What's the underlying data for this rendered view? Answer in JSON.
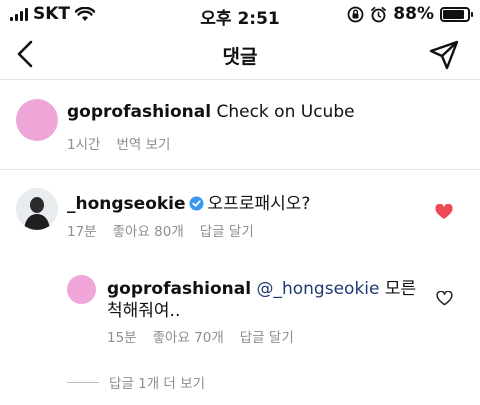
{
  "status_bar": {
    "carrier": "SKT",
    "time": "오후 2:51",
    "battery": "88%",
    "battery_level": 0.88
  },
  "nav": {
    "title": "댓글",
    "icons": [
      "back-chevron-icon",
      "send-icon"
    ]
  },
  "caption": {
    "username": "goprofashional",
    "text": "Check on Ucube",
    "time": "1시간",
    "translate_label": "번역 보기"
  },
  "comments": [
    {
      "username": "_hongseokie",
      "verified": true,
      "text": "오프로패시오?",
      "time": "17분",
      "likes": "좋아요 80개",
      "reply_label": "답글 달기",
      "liked": true
    },
    {
      "username": "goprofashional",
      "mention": "@_hongseokie",
      "text_line1": "모른",
      "text_line2": "척해줘여..",
      "time": "15분",
      "likes": "좋아요 70개",
      "reply_label": "답글 달기",
      "liked": false
    }
  ],
  "view_more": "답글 1개 더 보기",
  "colors": {
    "accent_heart": "#ed4956",
    "avatar_pink": "#f0a6d8",
    "meta_gray": "#8e8e8e",
    "verified_blue": "#3897f0"
  }
}
